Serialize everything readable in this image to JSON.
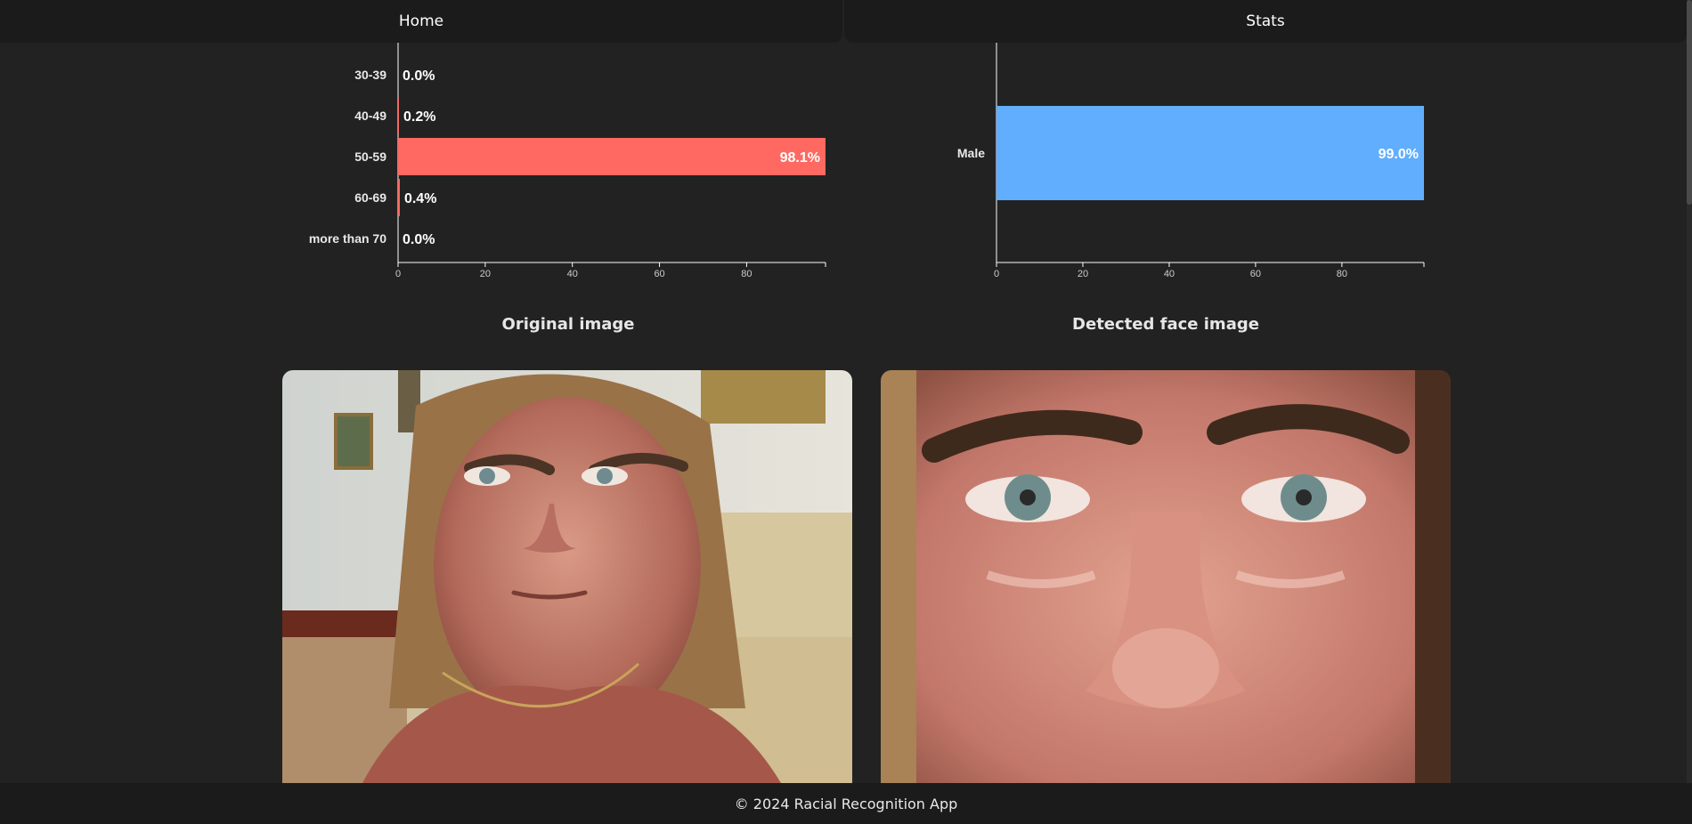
{
  "nav": {
    "home_label": "Home",
    "stats_label": "Stats"
  },
  "chart_data": [
    {
      "type": "bar",
      "orientation": "horizontal",
      "categories": [
        "30-39",
        "40-49",
        "50-59",
        "60-69",
        "more than 70"
      ],
      "values": [
        0.0,
        0.2,
        98.1,
        0.4,
        0.0
      ],
      "value_labels": [
        "0.0%",
        "0.2%",
        "98.1%",
        "0.4%",
        "0.0%"
      ],
      "x_ticks": [
        "0",
        "20",
        "40",
        "60",
        "80"
      ],
      "xlim": [
        0,
        98.1
      ],
      "color": "#ff6961"
    },
    {
      "type": "bar",
      "orientation": "horizontal",
      "categories": [
        "Male"
      ],
      "values": [
        99.0
      ],
      "value_labels": [
        "99.0%"
      ],
      "x_ticks": [
        "0",
        "20",
        "40",
        "60",
        "80"
      ],
      "xlim": [
        0,
        99.0
      ],
      "color": "#61aefe"
    }
  ],
  "images": {
    "original_title": "Original image",
    "detected_title": "Detected face image"
  },
  "footer": {
    "text": "© 2024 Racial Recognition App"
  }
}
